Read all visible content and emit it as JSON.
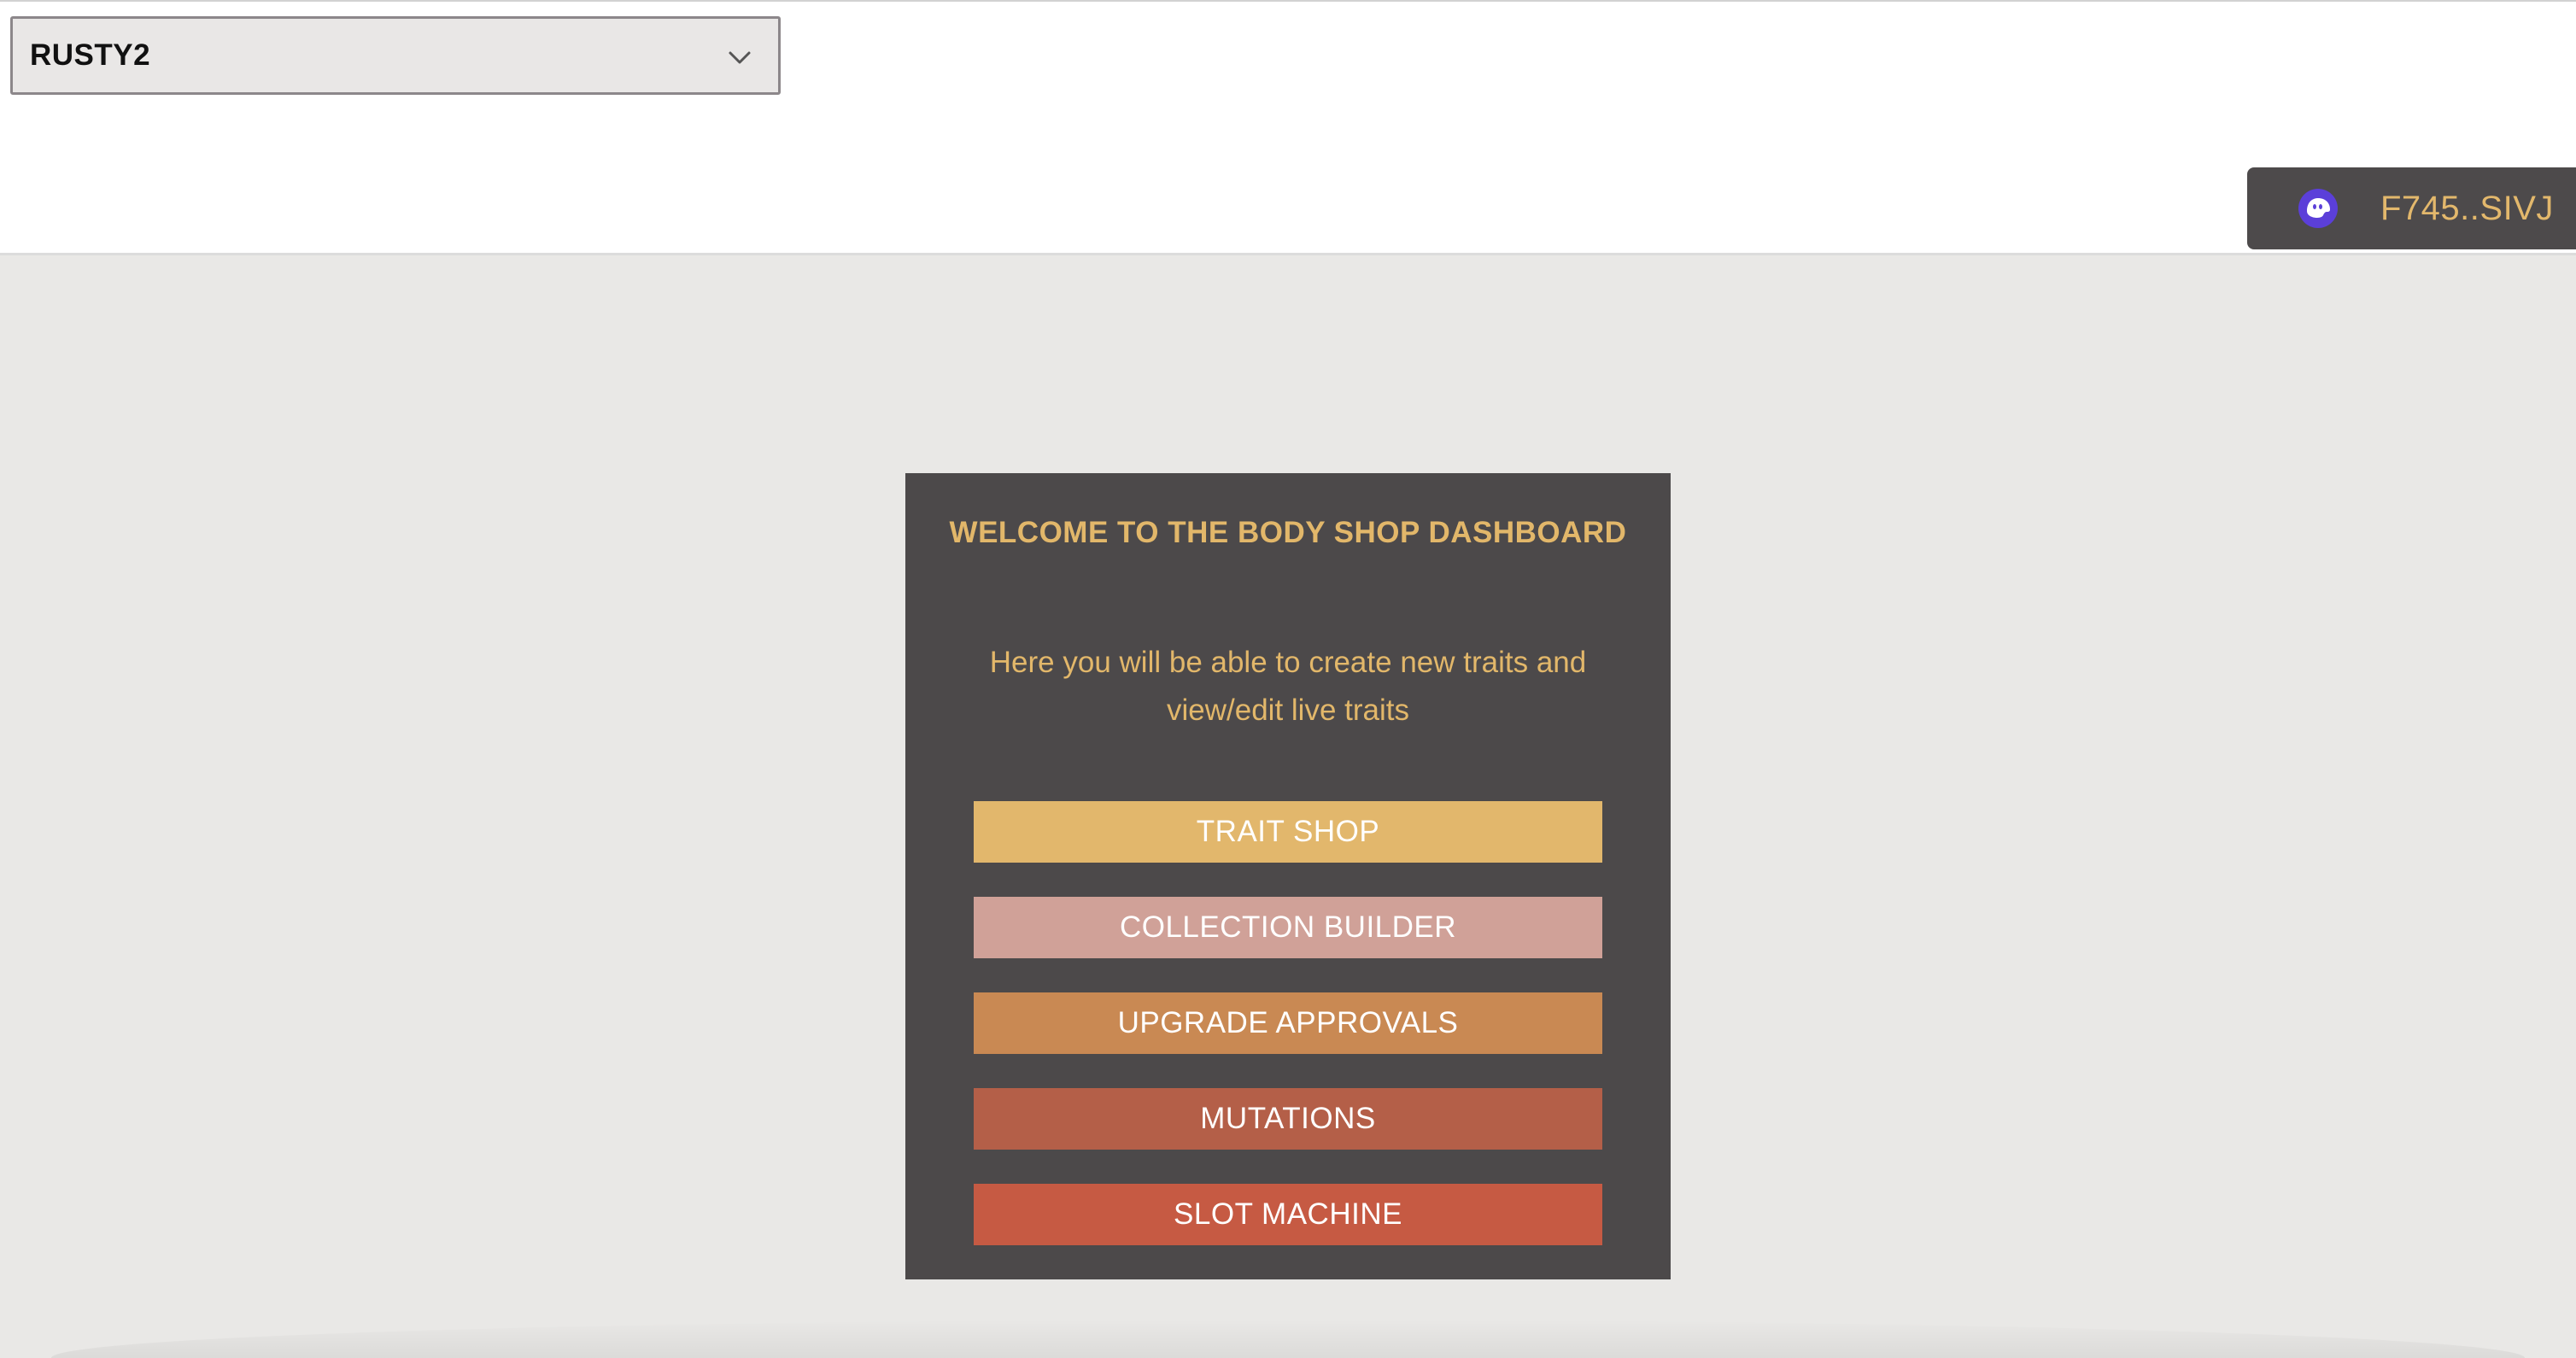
{
  "header": {
    "collection_select": {
      "selected": "RUSTY2"
    },
    "wallet": {
      "address": "F745..SIVJ",
      "icon": "phantom-ghost-icon"
    }
  },
  "dashboard": {
    "title": "WELCOME TO THE BODY SHOP DASHBOARD",
    "description": "Here you will be able to create new traits and view/edit live traits",
    "buttons": [
      {
        "label": "TRAIT SHOP",
        "color": "#e2b76c"
      },
      {
        "label": "COLLECTION BUILDER",
        "color": "#d0a198"
      },
      {
        "label": "UPGRADE APPROVALS",
        "color": "#c98953"
      },
      {
        "label": "MUTATIONS",
        "color": "#b45f48"
      },
      {
        "label": "SLOT MACHINE",
        "color": "#c65a43"
      }
    ]
  },
  "colors": {
    "accent_gold": "#e2b76a",
    "card_bg": "#4c494a",
    "page_bg": "#e9e8e6",
    "wallet_icon": "#5b3fd9"
  }
}
